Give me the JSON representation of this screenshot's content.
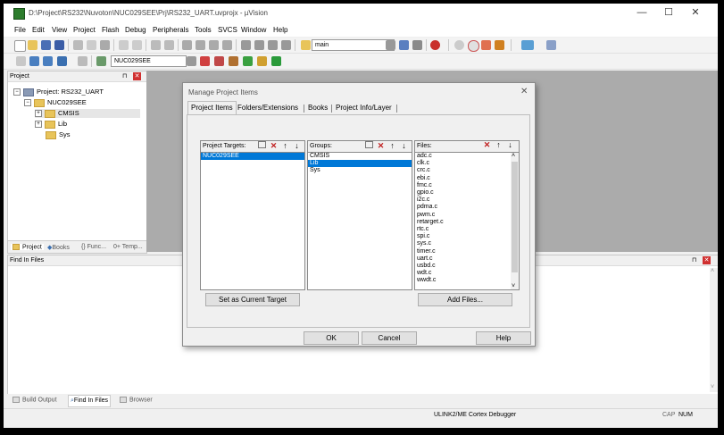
{
  "window": {
    "title": "D:\\Project\\RS232\\Nuvoton\\NUC029SEE\\Prj\\RS232_UART.uvprojx - µVision",
    "minimize": "—",
    "maximize": "☐",
    "close": "✕"
  },
  "menu": [
    "File",
    "Edit",
    "View",
    "Project",
    "Flash",
    "Debug",
    "Peripherals",
    "Tools",
    "SVCS",
    "Window",
    "Help"
  ],
  "toolbar": {
    "target_combo": "main",
    "target_name": "NUC029SEE"
  },
  "project_panel": {
    "header": "Project",
    "root": "Project: RS232_UART",
    "target": "NUC029SEE",
    "groups": [
      "CMSIS",
      "Lib",
      "Sys"
    ],
    "tabs": [
      "Project",
      "Books",
      "{} Func...",
      "0+ Temp..."
    ]
  },
  "find_panel": {
    "header": "Find In Files",
    "tabs": [
      "Build Output",
      "Find In Files",
      "Browser"
    ]
  },
  "status": {
    "debugger": "ULINK2/ME Cortex Debugger",
    "cap": "CAP",
    "num": "NUM"
  },
  "dialog": {
    "title": "Manage Project Items",
    "close": "✕",
    "tabs": [
      "Project Items",
      "Folders/Extensions",
      "Books",
      "Project Info/Layer"
    ],
    "targets_label": "Project Targets:",
    "targets": [
      "NUC029SEE"
    ],
    "groups_label": "Groups:",
    "groups": [
      "CMSIS",
      "Lib",
      "Sys"
    ],
    "files_label": "Files:",
    "files": [
      "adc.c",
      "clk.c",
      "crc.c",
      "ebi.c",
      "fmc.c",
      "gpio.c",
      "i2c.c",
      "pdma.c",
      "pwm.c",
      "retarget.c",
      "rtc.c",
      "spi.c",
      "sys.c",
      "timer.c",
      "uart.c",
      "usbd.c",
      "wdt.c",
      "wwdt.c"
    ],
    "set_current_target": "Set as Current Target",
    "add_files": "Add Files...",
    "ok": "OK",
    "cancel": "Cancel",
    "help": "Help"
  },
  "colors": {
    "selection": "#0078d7",
    "workspace_grey": "#ababab"
  }
}
